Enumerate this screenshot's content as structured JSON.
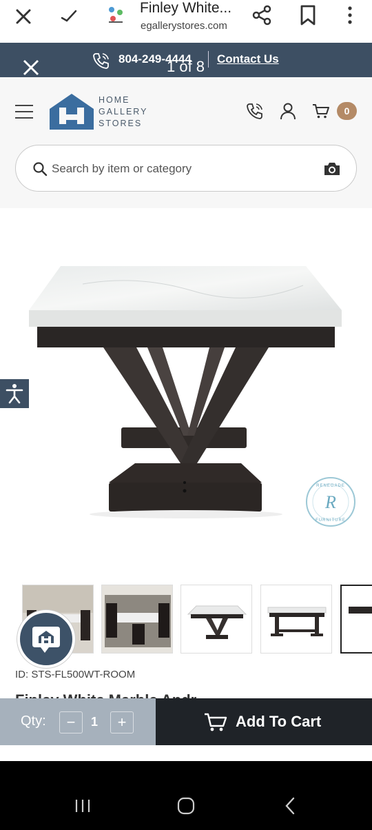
{
  "browser": {
    "tab_title": "Finley White...",
    "url": "egallerystores.com"
  },
  "promo": {
    "phone": "804-249-4444",
    "contact_label": "Contact Us",
    "image_counter": "1 of 8"
  },
  "header": {
    "logo_lines": [
      "HOME",
      "GALLERY",
      "STORES"
    ],
    "cart_count": "0"
  },
  "search": {
    "placeholder": "Search by item or category"
  },
  "product": {
    "badge_text": "RENEGADE FURNITURE",
    "id_label": "ID: STS-FL500WT-ROOM",
    "name_partial": "Finley White Marble Andr..."
  },
  "thumbnails": [
    {
      "name": "room-scene-1"
    },
    {
      "name": "room-scene-2"
    },
    {
      "name": "table-angle"
    },
    {
      "name": "table-front"
    },
    {
      "name": "partial-next"
    }
  ],
  "cart_bar": {
    "qty_label": "Qty:",
    "qty_minus": "−",
    "qty_value": "1",
    "qty_plus": "+",
    "add_label": "Add To Cart"
  },
  "colors": {
    "navy": "#3d4f63",
    "brand_blue": "#3b6d9f",
    "cart_badge": "#b48a66",
    "qty_bg": "#a6b1bc",
    "add_btn_bg": "#1f2328"
  }
}
